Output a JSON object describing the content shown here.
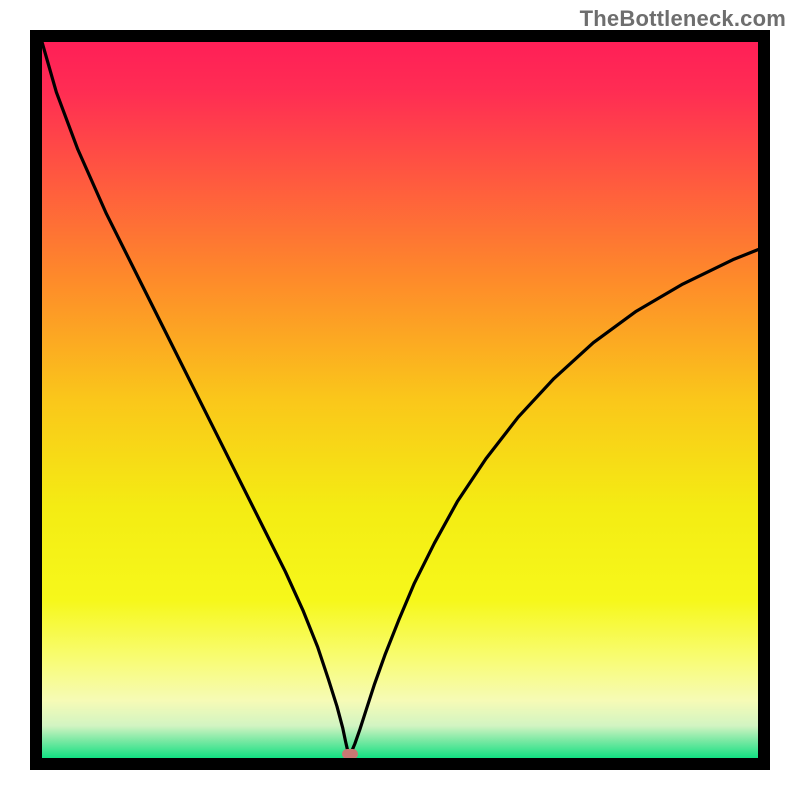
{
  "watermark": {
    "text": "TheBottleneck.com"
  },
  "chart_data": {
    "type": "line",
    "title": "",
    "xlabel": "",
    "ylabel": "",
    "xlim": [
      0,
      100
    ],
    "ylim": [
      0,
      100
    ],
    "grid": false,
    "gradient_stops": [
      {
        "pos": 0.0,
        "color": "#ff1f57"
      },
      {
        "pos": 0.07,
        "color": "#ff2d53"
      },
      {
        "pos": 0.18,
        "color": "#ff5541"
      },
      {
        "pos": 0.33,
        "color": "#fe8a2a"
      },
      {
        "pos": 0.5,
        "color": "#fac71a"
      },
      {
        "pos": 0.65,
        "color": "#f4ec13"
      },
      {
        "pos": 0.78,
        "color": "#f6f81b"
      },
      {
        "pos": 0.86,
        "color": "#f8fc72"
      },
      {
        "pos": 0.92,
        "color": "#f6fbb6"
      },
      {
        "pos": 0.955,
        "color": "#d2f4c2"
      },
      {
        "pos": 0.975,
        "color": "#7de9a4"
      },
      {
        "pos": 1.0,
        "color": "#12e082"
      }
    ],
    "series": [
      {
        "name": "curve",
        "x": [
          0,
          2,
          5,
          9,
          13,
          17,
          21,
          25,
          28,
          31,
          34,
          36.5,
          38.5,
          40.0,
          41.2,
          42.0,
          42.4,
          42.7,
          43.0,
          43.2,
          43.7,
          44.4,
          45.3,
          46.4,
          47.9,
          49.8,
          52.0,
          54.8,
          58.0,
          62.0,
          66.5,
          71.5,
          77.0,
          83.0,
          89.5,
          96.5,
          100.0
        ],
        "y": [
          100,
          93,
          85,
          76,
          68,
          60,
          52,
          44,
          38,
          32,
          26,
          20.5,
          15.5,
          11.0,
          7.2,
          4.2,
          2.3,
          1.0,
          0.2,
          0.8,
          2.0,
          4.0,
          6.8,
          10.2,
          14.4,
          19.2,
          24.4,
          30.0,
          35.8,
          41.8,
          47.6,
          53.0,
          58.0,
          62.4,
          66.2,
          69.6,
          71.0
        ]
      }
    ],
    "marker": {
      "x": 43.0,
      "y": 0.6,
      "color": "#c97874"
    },
    "colors": {
      "curve": "#000000",
      "frame": "#000000"
    }
  }
}
